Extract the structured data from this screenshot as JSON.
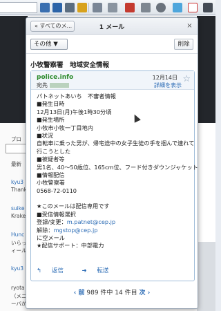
{
  "popup": {
    "back_label": "« すべてのメ...",
    "mail_count": "1 メール",
    "close_label": "×",
    "more_label": "その他 ▼",
    "delete_label": "削除",
    "subject": "小牧警察署　地域安全情報"
  },
  "message": {
    "sender": "police.info",
    "to_label": "宛先",
    "date": "12月14日",
    "details_label": "詳細を表示",
    "body_lines": [
      "パトネットあいち　不審者情報",
      "■発生日時",
      "12月13日(月)午後1時30分頃",
      "■発生場所",
      "小牧市小牧一丁目地内",
      "■状況",
      "自転車に乗った男が、帰宅途中の女子生徒の手を掴んで連れて",
      "行こうとした",
      "■被疑者等",
      "男1名、40〜50歳位、165cm位、フード付きダウンジャケット",
      "■情報配信",
      "小牧警察署",
      "0568-72-0110",
      "",
      "★このメールは配信専用です",
      "■受信情報選択",
      "登録/変更：",
      "解除：",
      "に空メール",
      "★配信サポート：中部電力"
    ],
    "register_email": "m.patnet@cep.jp",
    "cancel_email": "mgstop@cep.jp",
    "reply_label": "返信",
    "forward_label": "転送"
  },
  "pager": {
    "prev": "‹ 前",
    "text": "989 件中 14 件目",
    "next": "次 ›"
  },
  "background": {
    "lines": [
      "プロ",
      "最新",
      "kyu3",
      "Thank",
      "suike",
      "Krake",
      "Hunc",
      "いらっ",
      "ィール",
      "kyu3",
      "ryota",
      "（メニューバーも消して）",
      "ーバが拡張の中に、あのタブバー"
    ]
  }
}
